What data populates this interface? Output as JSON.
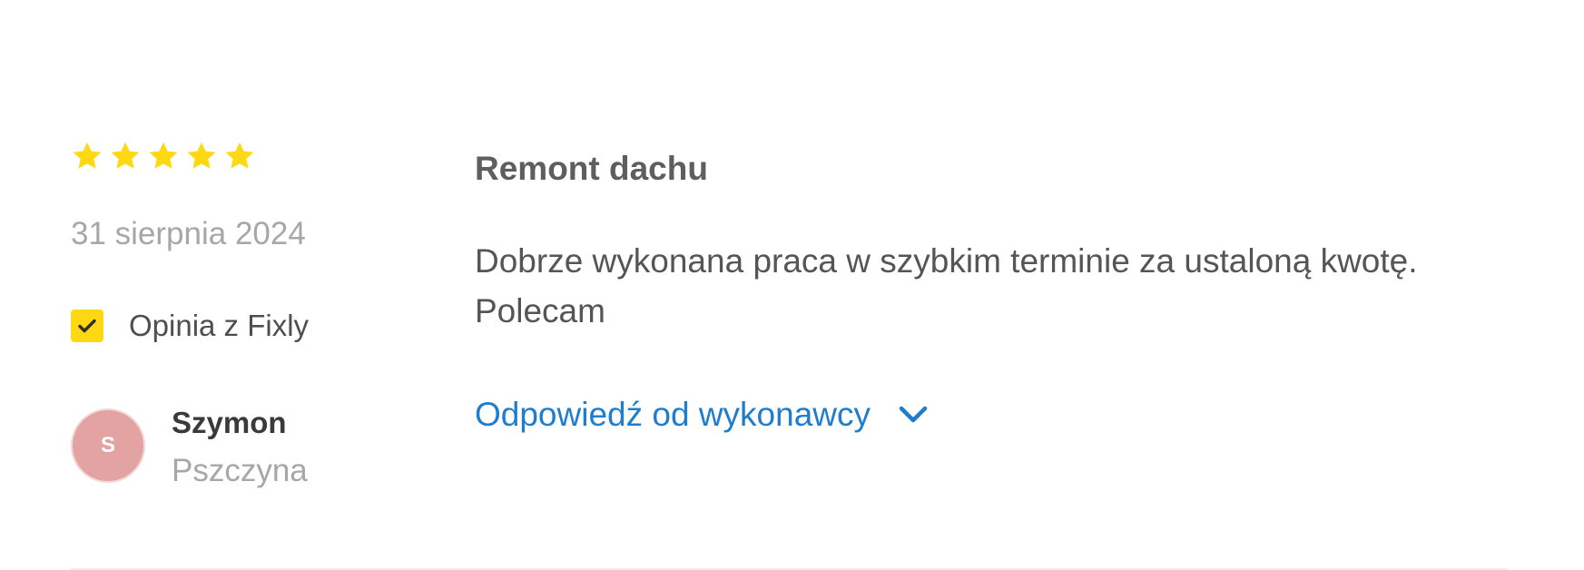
{
  "review": {
    "rating": 5,
    "rating_max": 5,
    "star_icon": "star-icon",
    "star_color": "#ffd814",
    "date": "31 sierpnia 2024",
    "source_label": "Opinia z Fixly",
    "source_check_icon": "check-icon",
    "source_check_color": "#ffd814",
    "author": {
      "initial": "S",
      "name": "Szymon",
      "city": "Pszczyna",
      "avatar_color": "#e3a3a3"
    },
    "job_title": "Remont dachu",
    "text": "Dobrze wykonana praca w szybkim terminie za ustaloną kwotę. Polecam",
    "reply_toggle_label": "Odpowiedź od wykonawcy",
    "reply_toggle_icon": "chevron-down-icon",
    "link_color": "#1e7dcf"
  }
}
